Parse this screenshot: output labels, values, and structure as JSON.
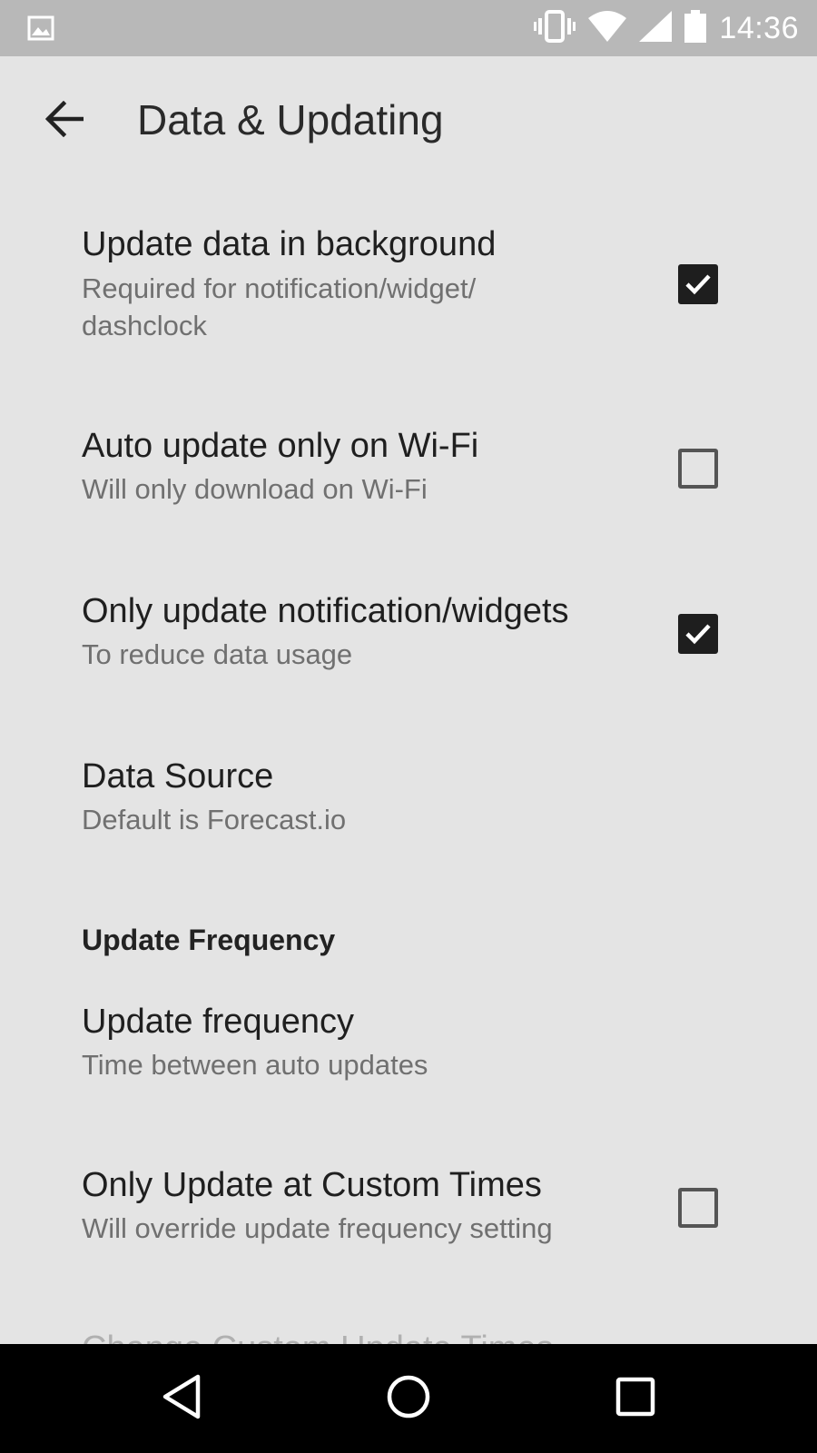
{
  "status_bar": {
    "time": "14:36",
    "icons": [
      "image-icon",
      "vibrate-icon",
      "wifi-icon",
      "signal-icon",
      "battery-icon"
    ]
  },
  "toolbar": {
    "title": "Data & Updating",
    "back_icon": "back-arrow-icon"
  },
  "preferences": [
    {
      "title": "Update data in background",
      "summary": "Required for notification/widget/ dashclock",
      "checked": true
    },
    {
      "title": "Auto update only on Wi-Fi",
      "summary": "Will only download on Wi-Fi",
      "checked": false
    },
    {
      "title": "Only update notification/widgets",
      "summary": "To reduce data usage",
      "checked": true
    },
    {
      "title": "Data Source",
      "summary": "Default is Forecast.io"
    }
  ],
  "section": {
    "header": "Update Frequency",
    "items": [
      {
        "title": "Update frequency",
        "summary": "Time between auto updates"
      },
      {
        "title": "Only Update at Custom Times",
        "summary": "Will override update frequency setting",
        "checked": false
      }
    ],
    "partial_item_title": "Change Custom Update Times"
  },
  "nav_bar": {
    "icons": [
      "back-triangle-icon",
      "home-circle-icon",
      "recents-square-icon"
    ]
  },
  "colors": {
    "background": "#e4e4e4",
    "status_bar": "#b8b8b8",
    "checkbox_checked": "#1e1e1e",
    "nav_bar": "#000000"
  }
}
